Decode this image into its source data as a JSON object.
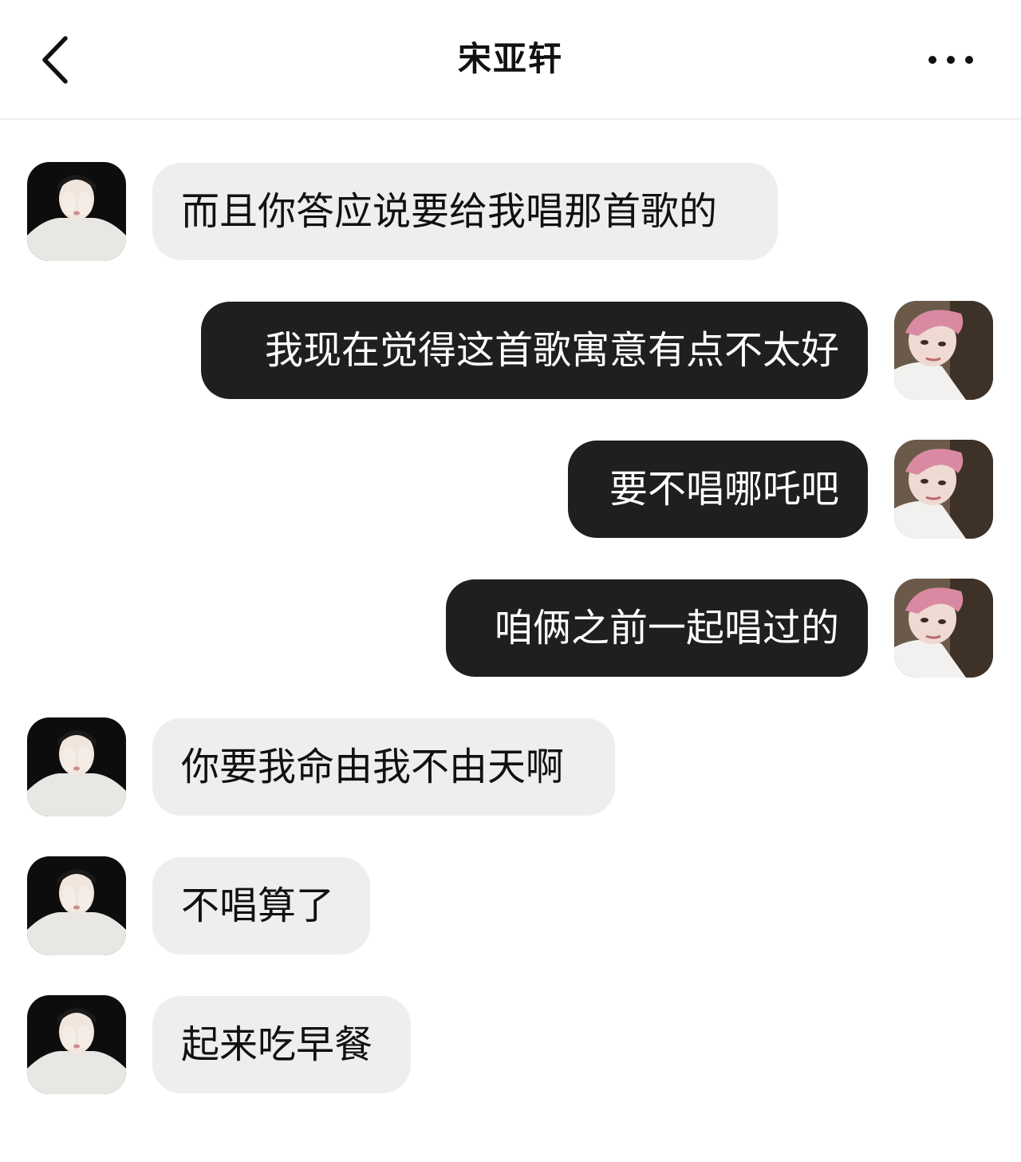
{
  "header": {
    "title": "宋亚轩",
    "back_icon": "chevron-left-icon",
    "more_icon": "more-horizontal-icon"
  },
  "colors": {
    "received_bubble": "#eeeeee",
    "sent_bubble": "#1f1f1f",
    "received_text": "#111111",
    "sent_text": "#ffffff"
  },
  "messages": [
    {
      "sender": "other",
      "text": "而且你答应说要给我唱那首歌的"
    },
    {
      "sender": "me",
      "text": "我现在觉得这首歌寓意有点不太好"
    },
    {
      "sender": "me",
      "text": "要不唱哪吒吧"
    },
    {
      "sender": "me",
      "text": "咱俩之前一起唱过的"
    },
    {
      "sender": "other",
      "text": "你要我命由我不由天啊"
    },
    {
      "sender": "other",
      "text": "不唱算了"
    },
    {
      "sender": "other",
      "text": "起来吃早餐"
    }
  ]
}
